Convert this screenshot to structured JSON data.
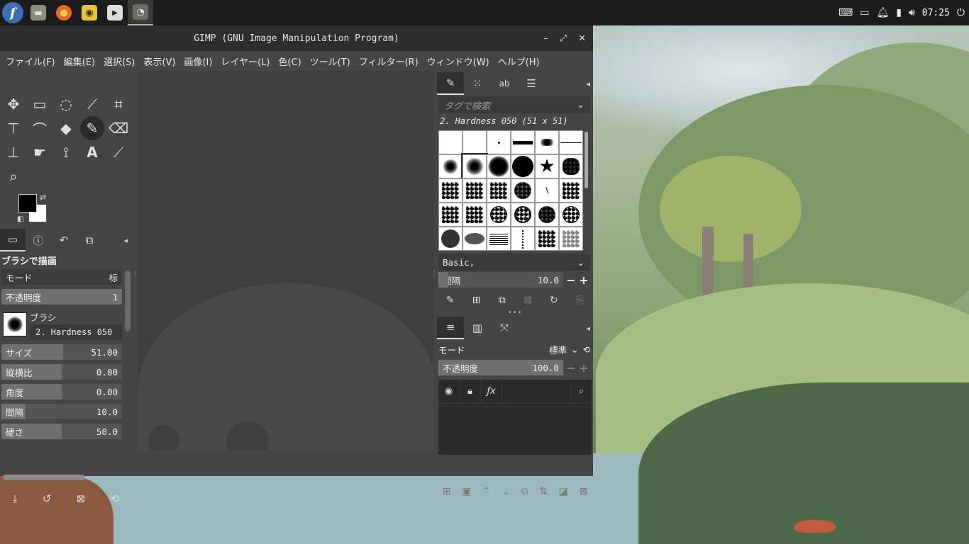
{
  "panel": {
    "launchers": [
      {
        "name": "fedora-menu",
        "glyph": "f"
      },
      {
        "name": "files",
        "glyph": "▬"
      },
      {
        "name": "firefox",
        "glyph": "●"
      },
      {
        "name": "audio",
        "glyph": "◉"
      },
      {
        "name": "media",
        "glyph": "▶"
      },
      {
        "name": "gimp",
        "glyph": "◔"
      }
    ],
    "clock": "07:25"
  },
  "window": {
    "title": "GIMP (GNU Image Manipulation Program)",
    "controls": {
      "minimize": "–",
      "maximize": "⤢",
      "close": "✕"
    }
  },
  "menu": [
    "ファイル(F)",
    "編集(E)",
    "選択(S)",
    "表示(V)",
    "画像(I)",
    "レイヤー(L)",
    "色(C)",
    "ツール(T)",
    "フィルター(R)",
    "ウィンドウ(W)",
    "ヘルプ(H)"
  ],
  "tool_options": {
    "title": "ブラシで描画",
    "mode_label": "モード",
    "mode_value": "标",
    "opacity_label": "不透明度",
    "opacity_value": "1",
    "brush_label": "ブラシ",
    "brush_name": "2. Hardness 050",
    "rows": [
      {
        "label": "サイズ",
        "value": "51.00",
        "fill": 0.51
      },
      {
        "label": "縦横比",
        "value": "0.00",
        "fill": 0.5
      },
      {
        "label": "角度",
        "value": "0.00",
        "fill": 0.5
      },
      {
        "label": "間隔",
        "value": "10.0",
        "fill": 0.2
      },
      {
        "label": "硬さ",
        "value": "50.0",
        "fill": 0.5
      }
    ]
  },
  "brushes": {
    "tag_placeholder": "タグで検索",
    "current": "2. Hardness 050 (51 x 51)",
    "set": "Basic,",
    "spacing_label": "間隔",
    "spacing_value": "10.0"
  },
  "layers": {
    "mode_label": "モード",
    "mode_value": "標準",
    "opacity_label": "不透明度",
    "opacity_value": "100.0"
  }
}
